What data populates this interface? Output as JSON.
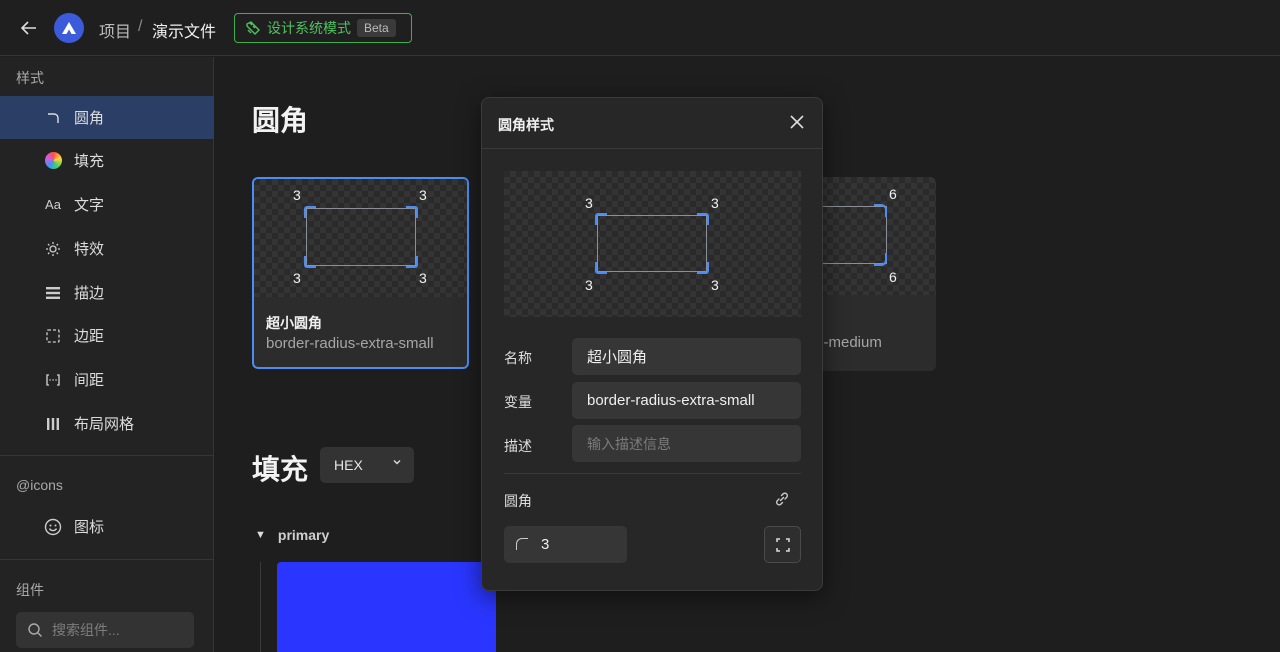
{
  "topbar": {
    "breadcrumb_project": "项目",
    "breadcrumb_sep": "/",
    "breadcrumb_file": "演示文件",
    "ds_mode_label": "设计系统模式",
    "ds_mode_badge": "Beta"
  },
  "sidebar": {
    "styles_section": "样式",
    "items": [
      {
        "label": "圆角",
        "icon": "corner-radius-icon",
        "active": true
      },
      {
        "label": "填充",
        "icon": "color-wheel-icon"
      },
      {
        "label": "文字",
        "icon": "typography-icon",
        "glyph": "Aa"
      },
      {
        "label": "特效",
        "icon": "sun-effect-icon"
      },
      {
        "label": "描边",
        "icon": "stroke-icon"
      },
      {
        "label": "边距",
        "icon": "padding-icon"
      },
      {
        "label": "间距",
        "icon": "spacing-icon"
      },
      {
        "label": "布局网格",
        "icon": "layout-grid-icon"
      }
    ],
    "icons_section": "@icons",
    "icons_item": "图标",
    "components_section": "组件",
    "search_placeholder": "搜索组件..."
  },
  "main": {
    "radius_heading": "圆角",
    "cards": [
      {
        "name": "超小圆角",
        "variable": "border-radius-extra-small",
        "corners": [
          "3",
          "3",
          "3",
          "3"
        ],
        "selected": true
      },
      {
        "name": "",
        "variable": "s-medium",
        "corners": [
          "6",
          "6"
        ],
        "selected": false
      }
    ],
    "fill_heading": "填充",
    "format_select": "HEX",
    "group_name": "primary",
    "primary_color": "#2a36ff"
  },
  "modal": {
    "title": "圆角样式",
    "preview_corners": [
      "3",
      "3",
      "3",
      "3"
    ],
    "name_label": "名称",
    "name_value": "超小圆角",
    "variable_label": "变量",
    "variable_value": "border-radius-extra-small",
    "desc_label": "描述",
    "desc_placeholder": "输入描述信息",
    "radius_label": "圆角",
    "radius_value": "3"
  },
  "colors": {
    "accent": "#4b8cf5",
    "ds_mode_green": "#4fc15f",
    "active_nav": "#2b3e66"
  }
}
